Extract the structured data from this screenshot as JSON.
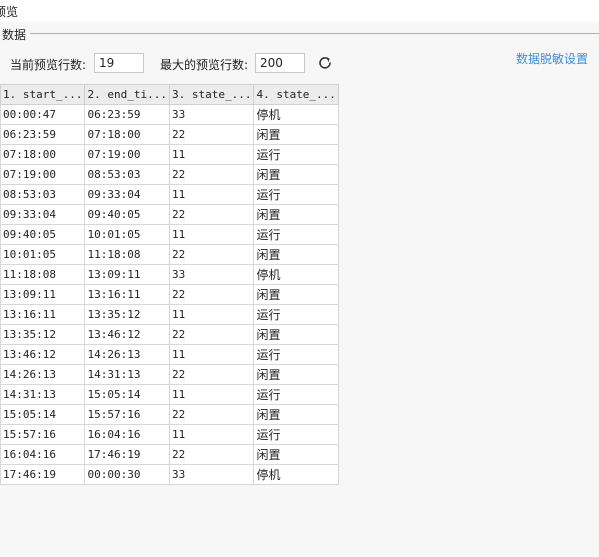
{
  "window": {
    "title": "预览"
  },
  "panel": {
    "legend": "数据"
  },
  "controls": {
    "current_rows_label": "当前预览行数:",
    "current_rows_value": "19",
    "max_rows_label": "最大的预览行数:",
    "max_rows_value": "200",
    "refresh_icon": "refresh-icon",
    "masking_link": "数据脱敏设置"
  },
  "colors": {
    "link": "#3b8fd6",
    "band": "#f7f7f7",
    "header": "#ececec"
  },
  "table": {
    "columns": [
      "1. start_...",
      "2. end_ti...",
      "3. state_...",
      "4. state_..."
    ],
    "rows": [
      [
        "00:00:47",
        "06:23:59",
        "33",
        "停机"
      ],
      [
        "06:23:59",
        "07:18:00",
        "22",
        "闲置"
      ],
      [
        "07:18:00",
        "07:19:00",
        "11",
        "运行"
      ],
      [
        "07:19:00",
        "08:53:03",
        "22",
        "闲置"
      ],
      [
        "08:53:03",
        "09:33:04",
        "11",
        "运行"
      ],
      [
        "09:33:04",
        "09:40:05",
        "22",
        "闲置"
      ],
      [
        "09:40:05",
        "10:01:05",
        "11",
        "运行"
      ],
      [
        "10:01:05",
        "11:18:08",
        "22",
        "闲置"
      ],
      [
        "11:18:08",
        "13:09:11",
        "33",
        "停机"
      ],
      [
        "13:09:11",
        "13:16:11",
        "22",
        "闲置"
      ],
      [
        "13:16:11",
        "13:35:12",
        "11",
        "运行"
      ],
      [
        "13:35:12",
        "13:46:12",
        "22",
        "闲置"
      ],
      [
        "13:46:12",
        "14:26:13",
        "11",
        "运行"
      ],
      [
        "14:26:13",
        "14:31:13",
        "22",
        "闲置"
      ],
      [
        "14:31:13",
        "15:05:14",
        "11",
        "运行"
      ],
      [
        "15:05:14",
        "15:57:16",
        "22",
        "闲置"
      ],
      [
        "15:57:16",
        "16:04:16",
        "11",
        "运行"
      ],
      [
        "16:04:16",
        "17:46:19",
        "22",
        "闲置"
      ],
      [
        "17:46:19",
        "00:00:30",
        "33",
        "停机"
      ]
    ]
  }
}
